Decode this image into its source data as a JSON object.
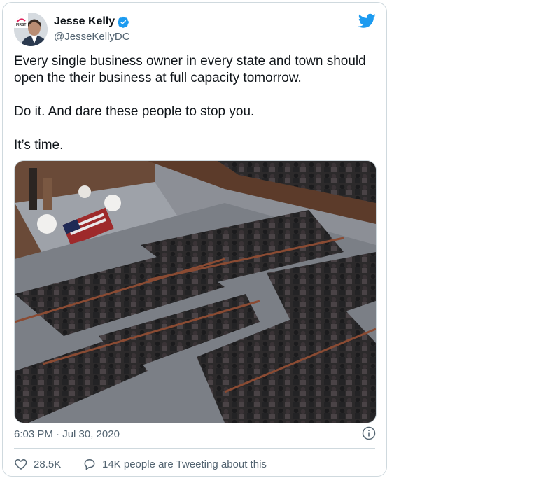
{
  "tweet": {
    "author": {
      "display_name": "Jesse Kelly",
      "handle": "@JesseKellyDC",
      "avatar_text": "FIRST"
    },
    "text_paragraphs": [
      "Every single business owner in every state and town should open the their business at full capacity tomorrow.",
      "Do it. And dare these people to stop you.",
      "It’s time."
    ],
    "timestamp": "6:03 PM · Jul 30, 2020",
    "stats": {
      "likes": "28.5K",
      "tweeting_text": "14K people are Tweeting about this"
    }
  },
  "colors": {
    "accent": "#1d9bf0",
    "text": "#0f1419",
    "secondary_text": "#536471",
    "border": "#cfd9de"
  },
  "icons": [
    "verified-badge-icon",
    "twitter-bird-icon",
    "info-icon",
    "heart-icon",
    "speech-bubble-icon"
  ]
}
